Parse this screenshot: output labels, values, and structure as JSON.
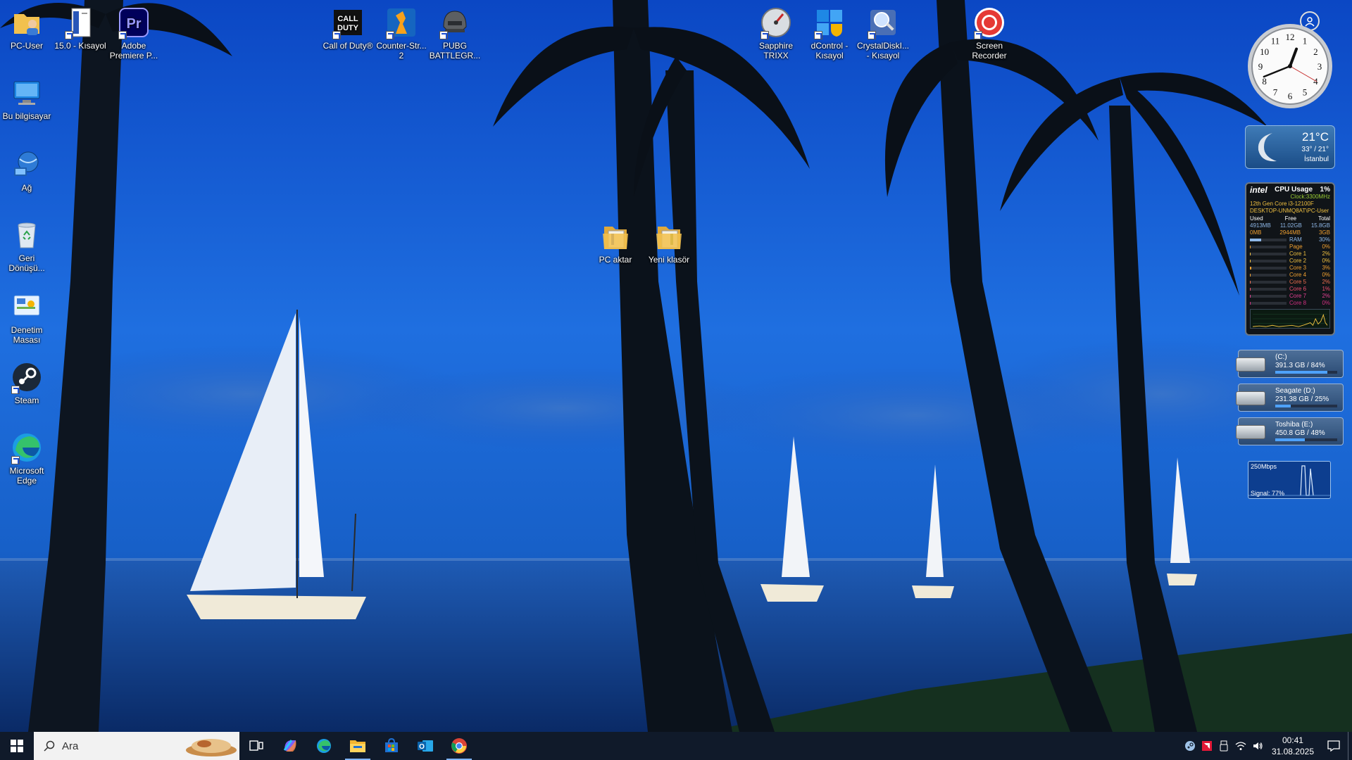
{
  "desktop": {
    "icons": [
      {
        "label": "PC-User"
      },
      {
        "label": "15.0 - Kısayol"
      },
      {
        "label": "Adobe Premiere P..."
      },
      {
        "label": "Bu bilgisayar"
      },
      {
        "label": "Ağ"
      },
      {
        "label": "Geri Dönüşü..."
      },
      {
        "label": "Denetim Masası"
      },
      {
        "label": "Steam"
      },
      {
        "label": "Microsoft Edge"
      },
      {
        "label": "Call of Duty®"
      },
      {
        "label": "Counter-Str... 2"
      },
      {
        "label": "PUBG BATTLEGR..."
      },
      {
        "label": "Sapphire TRIXX"
      },
      {
        "label": "dControl - Kısayol"
      },
      {
        "label": "CrystalDiskI... - Kısayol"
      },
      {
        "label": "Screen Recorder"
      },
      {
        "label": "PC aktar"
      },
      {
        "label": "Yeni klasör"
      }
    ]
  },
  "gadgets": {
    "clock": {
      "hour": 12,
      "minute": 41,
      "second": 20
    },
    "weather": {
      "temp": "21°C",
      "range": "33° / 21°",
      "city": "İstanbul"
    },
    "cpu": {
      "brand": "intel",
      "title": "CPU Usage",
      "usage": "1%",
      "clock": "Clock:3300MHz",
      "model": "12th Gen Core i3-12100F",
      "host": "DESKTOP-UNMQ8AT\\PC-User",
      "headers": [
        "Used",
        "Free",
        "Total"
      ],
      "ram_row": [
        "4913MB",
        "11.02GB",
        "15.8GB"
      ],
      "page_row": [
        "0MB",
        "2944MB",
        "3GB"
      ],
      "meters": [
        {
          "name": "RAM",
          "value": "30%",
          "fraction": 0.3
        },
        {
          "name": "Page",
          "value": "0%",
          "fraction": 0.0
        },
        {
          "name": "Core 1",
          "value": "2%",
          "fraction": 0.02
        },
        {
          "name": "Core 2",
          "value": "0%",
          "fraction": 0.0
        },
        {
          "name": "Core 3",
          "value": "3%",
          "fraction": 0.03
        },
        {
          "name": "Core 4",
          "value": "0%",
          "fraction": 0.0
        },
        {
          "name": "Core 5",
          "value": "2%",
          "fraction": 0.02
        },
        {
          "name": "Core 6",
          "value": "1%",
          "fraction": 0.01
        },
        {
          "name": "Core 7",
          "value": "2%",
          "fraction": 0.02
        },
        {
          "name": "Core 8",
          "value": "0%",
          "fraction": 0.0
        }
      ]
    },
    "drives": [
      {
        "name": "(C:)",
        "info": "391.3 GB / 84%",
        "fraction": 0.84
      },
      {
        "name": "Seagate (D:)",
        "info": "231.38 GB / 25%",
        "fraction": 0.25
      },
      {
        "name": "Toshiba (E:)",
        "info": "450.8 GB / 48%",
        "fraction": 0.48
      }
    ],
    "network": {
      "speed": "250Mbps",
      "signal": "Signal: 77%"
    }
  },
  "taskbar": {
    "search_placeholder": "Ara",
    "apps": [
      "task-view",
      "copilot",
      "edge",
      "file-explorer",
      "microsoft-store",
      "outlook",
      "chrome"
    ],
    "clock_time": "00:41",
    "clock_date": "31.08.2025"
  }
}
